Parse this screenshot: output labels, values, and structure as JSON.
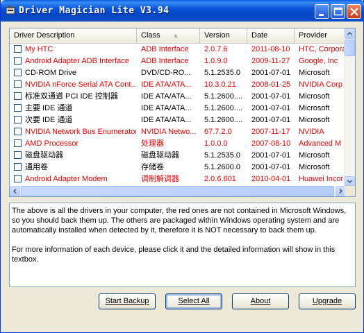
{
  "window": {
    "title": "Driver Magician Lite V3.94"
  },
  "table": {
    "columns": [
      "Driver Description",
      "Class",
      "Version",
      "Date",
      "Provider"
    ],
    "sort_column": "Class",
    "rows": [
      {
        "desc": "My HTC",
        "class": "ADB Interface",
        "version": "2.0.7.6",
        "date": "2011-08-10",
        "provider": "HTC, Corpora",
        "red": true
      },
      {
        "desc": "Android Adapter ADB Interface",
        "class": "ADB Interface",
        "version": "1.0.9.0",
        "date": "2009-11-27",
        "provider": "Google, Inc",
        "red": true
      },
      {
        "desc": "CD-ROM Drive",
        "class": "DVD/CD-RO...",
        "version": "5.1.2535.0",
        "date": "2001-07-01",
        "provider": "Microsoft",
        "red": false
      },
      {
        "desc": "NVIDIA nForce Serial ATA Cont...",
        "class": "IDE ATA/ATA...",
        "version": "10.3.0.21",
        "date": "2008-01-25",
        "provider": "NVIDIA Corp",
        "red": true
      },
      {
        "desc": "标准双通道 PCI IDE 控制器",
        "class": "IDE ATA/ATA...",
        "version": "5.1.2600....",
        "date": "2001-07-01",
        "provider": "Microsoft",
        "red": false
      },
      {
        "desc": "主要 IDE 通道",
        "class": "IDE ATA/ATA...",
        "version": "5.1.2600....",
        "date": "2001-07-01",
        "provider": "Microsoft",
        "red": false
      },
      {
        "desc": "次要 IDE 通道",
        "class": "IDE ATA/ATA...",
        "version": "5.1.2600....",
        "date": "2001-07-01",
        "provider": "Microsoft",
        "red": false
      },
      {
        "desc": "NVIDIA Network Bus Enumerator",
        "class": "NVIDIA Netwo...",
        "version": "67.7.2.0",
        "date": "2007-11-17",
        "provider": "NVIDIA",
        "red": true
      },
      {
        "desc": "AMD Processor",
        "class": "处理器",
        "version": "1.0.0.0",
        "date": "2007-08-10",
        "provider": "Advanced M",
        "red": true
      },
      {
        "desc": "磁盘驱动器",
        "class": "磁盘驱动器",
        "version": "5.1.2535.0",
        "date": "2001-07-01",
        "provider": "Microsoft",
        "red": false
      },
      {
        "desc": "通用卷",
        "class": "存储卷",
        "version": "5.1.2600.0",
        "date": "2001-07-01",
        "provider": "Microsoft",
        "red": false
      },
      {
        "desc": "Android Adapter Modem",
        "class": "调制解调器",
        "version": "2.0.6.601",
        "date": "2010-04-01",
        "provider": "Huawei Incor",
        "red": true
      }
    ]
  },
  "info": {
    "paragraph1": "The above is all the drivers in your computer, the red ones are not contained in Microsoft Windows, so you should back them up. The others are packaged within Windows operating system and are automatically installed when detected by it, therefore it is NOT necessary to back them up.",
    "paragraph2": "For more information of each device, please click it and the detailed information will show in this textbox."
  },
  "buttons": {
    "start_backup": "Start Backup",
    "select_all": "Select All",
    "about": "About",
    "upgrade": "Upgrade"
  },
  "colors": {
    "not_in_windows": "#e00000",
    "title_bar": "#0853d8"
  }
}
